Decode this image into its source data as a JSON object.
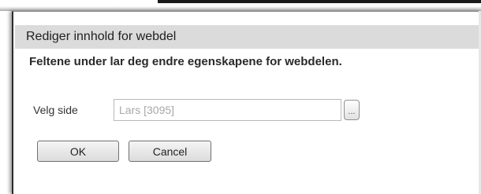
{
  "dialog": {
    "title": "Rediger innhold for webdel",
    "subtitle": "Feltene under lar deg endre egenskapene for webdelen."
  },
  "form": {
    "page_label": "Velg side",
    "page_value": "Lars [3095]",
    "browse_label": "..."
  },
  "buttons": {
    "ok_label": "OK",
    "cancel_label": "Cancel"
  }
}
